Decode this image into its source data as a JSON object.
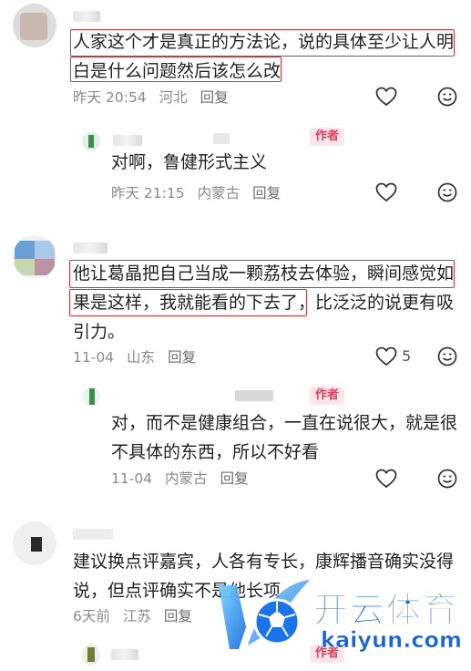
{
  "comments": [
    {
      "text_line1": "人家这个才是真正的方法论，说的具体至少让人明",
      "text_line2": "白是什么问题然后该怎么改",
      "time": "昨天 20:54",
      "location": "河北",
      "reply_label": "回复",
      "reply": {
        "author_tag": "作者",
        "text": "对啊，鲁健形式主义",
        "time": "昨天 21:15",
        "location": "内蒙古",
        "reply_label": "回复"
      }
    },
    {
      "text_line1": "他让葛晶把自己当成一颗荔枝去体验，瞬间感觉如",
      "text_line2a": "果是这样，我就能看的下去了，",
      "text_line2b": "比泛泛的说更有吸",
      "text_line3": "引力。",
      "time": "11-04",
      "location": "山东",
      "reply_label": "回复",
      "likes": "5",
      "reply": {
        "author_tag": "作者",
        "text_line1": "对，而不是健康组合，一直在说很大，就是很",
        "text_line2": "不具体的东西，所以不好看",
        "time": "11-04",
        "location": "内蒙古",
        "reply_label": "回复"
      }
    },
    {
      "text_line1": "建议换点评嘉宾，人各有专长，康辉播音确实没得",
      "text_line2": "说，但点评确实不是他长项",
      "time": "6天前",
      "location": "江苏",
      "reply_label": "回复",
      "reply": {
        "author_tag": "作者"
      }
    }
  ],
  "watermark": {
    "brand": "开云体育",
    "domain": "kaiyun.com"
  },
  "icons": {
    "like": "heart-outline-icon",
    "emoji": "smiley-icon"
  },
  "colors": {
    "highlight": "#c9383c",
    "author_tag_bg": "#fde6ea",
    "author_tag_fg": "#e33d5c",
    "meta": "#8a8a8a"
  }
}
